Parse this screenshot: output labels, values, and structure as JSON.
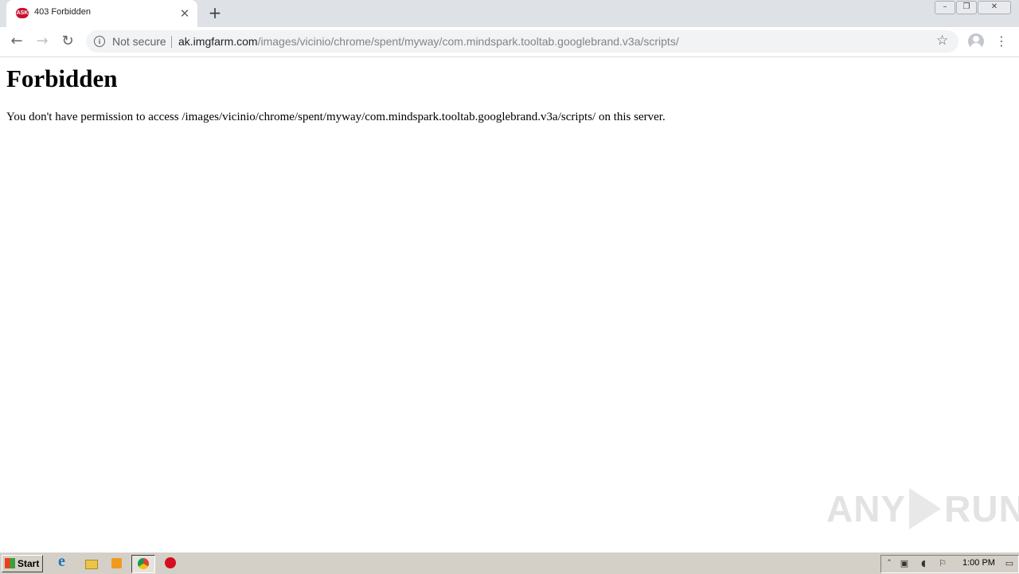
{
  "browser": {
    "tab": {
      "favicon": "ask-logo",
      "favicon_text": "ASK",
      "title": "403 Forbidden"
    },
    "omnibox": {
      "security_label": "Not secure",
      "url_host": "ak.imgfarm.com",
      "url_path": "/images/vicinio/chrome/spent/myway/com.mindspark.tooltab.googlebrand.v3a/scripts/"
    }
  },
  "page": {
    "heading": "Forbidden",
    "message": "You don't have permission to access /images/vicinio/chrome/spent/myway/com.mindspark.tooltab.googlebrand.v3a/scripts/ on this server."
  },
  "watermark": {
    "left": "ANY",
    "right": "RUN"
  },
  "taskbar": {
    "start_label": "Start",
    "icons": [
      "internet-explorer-icon",
      "folder-icon",
      "media-player-icon",
      "chrome-icon",
      "opera-icon"
    ],
    "clock": "1:00 PM"
  }
}
